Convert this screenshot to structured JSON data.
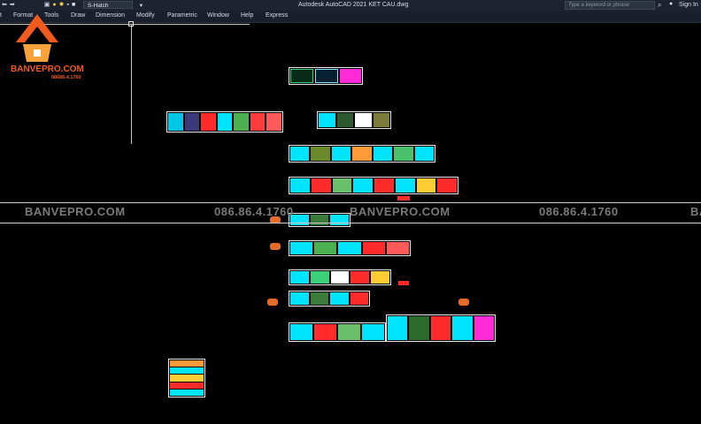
{
  "window": {
    "title": "Autodesk AutoCAD 2021   KET CAU.dwg",
    "layer_name": "S-Hatch",
    "search_placeholder": "Type a keyword or phrase",
    "sign_in": "Sign In"
  },
  "menu": {
    "items": [
      "t",
      "Format",
      "Tools",
      "Draw",
      "Dimension",
      "Modify",
      "Parametric",
      "Window",
      "Help",
      "Express"
    ]
  },
  "watermark": {
    "brand": "BANVEPRO.COM",
    "phone": "086.86.4.1760",
    "brand_cut": "BAN"
  },
  "logo": {
    "brand": "BANVEPRO.COM",
    "phone": "08686.4.1760"
  },
  "colors": {
    "accent_orange": "#f25a1e",
    "sheet_cyan": "#00e5ff",
    "sheet_red": "#ff2a2a",
    "sheet_magenta": "#ff2bd6"
  }
}
